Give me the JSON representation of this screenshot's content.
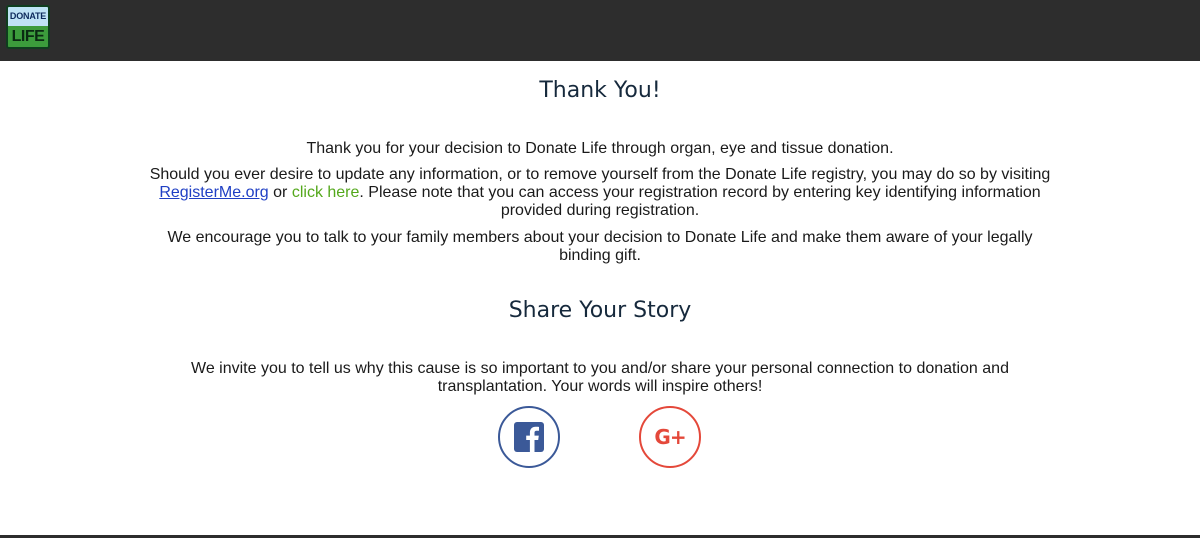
{
  "header": {
    "logo": {
      "top_text": "DONATE",
      "bottom_text": "LIFE"
    }
  },
  "main": {
    "title": "Thank You!",
    "thank_you_text": "Thank you for your decision to Donate Life through organ, eye and tissue donation.",
    "update": {
      "text_before": "Should you ever desire to update any information, or to remove yourself from the Donate Life registry, you may do so by visiting ",
      "registerme_link": "RegisterMe.org",
      "text_or": " or ",
      "click_here_link": "click here",
      "text_after": ". Please note that you can access your registration record by entering key identifying information provided during registration."
    },
    "encourage_text": "We encourage you to talk to your family members about your decision to Donate Life and make them aware of your legally binding gift.",
    "share_title": "Share Your Story",
    "share_text": "We invite you to tell us why this cause is so important to you and/or share your personal connection to donation and transplantation. Your words will inspire others!"
  },
  "social": {
    "facebook": {
      "icon": "facebook-icon",
      "color": "#3b5998"
    },
    "googleplus": {
      "icon": "google-plus-icon",
      "label": "G+",
      "color": "#e4483a"
    }
  },
  "colors": {
    "header_bg": "#2d2d2d",
    "link_blue": "#1f3fc4",
    "link_green": "#54a81c",
    "heading": "#16293c"
  }
}
